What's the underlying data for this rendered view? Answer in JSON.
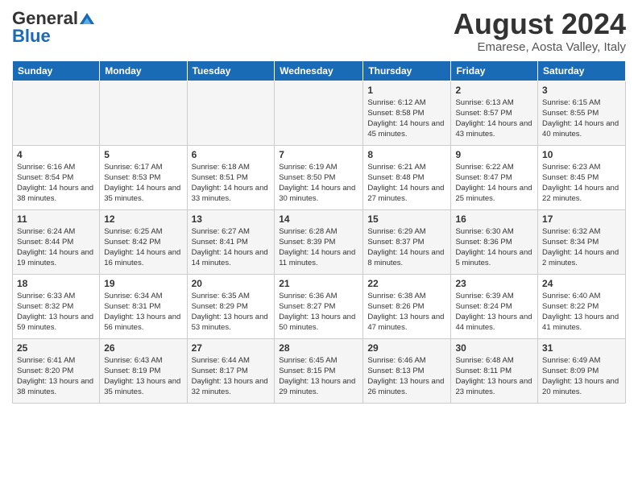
{
  "logo": {
    "general": "General",
    "blue": "Blue"
  },
  "title": "August 2024",
  "location": "Emarese, Aosta Valley, Italy",
  "days_of_week": [
    "Sunday",
    "Monday",
    "Tuesday",
    "Wednesday",
    "Thursday",
    "Friday",
    "Saturday"
  ],
  "weeks": [
    [
      {
        "day": "",
        "info": ""
      },
      {
        "day": "",
        "info": ""
      },
      {
        "day": "",
        "info": ""
      },
      {
        "day": "",
        "info": ""
      },
      {
        "day": "1",
        "info": "Sunrise: 6:12 AM\nSunset: 8:58 PM\nDaylight: 14 hours and 45 minutes."
      },
      {
        "day": "2",
        "info": "Sunrise: 6:13 AM\nSunset: 8:57 PM\nDaylight: 14 hours and 43 minutes."
      },
      {
        "day": "3",
        "info": "Sunrise: 6:15 AM\nSunset: 8:55 PM\nDaylight: 14 hours and 40 minutes."
      }
    ],
    [
      {
        "day": "4",
        "info": "Sunrise: 6:16 AM\nSunset: 8:54 PM\nDaylight: 14 hours and 38 minutes."
      },
      {
        "day": "5",
        "info": "Sunrise: 6:17 AM\nSunset: 8:53 PM\nDaylight: 14 hours and 35 minutes."
      },
      {
        "day": "6",
        "info": "Sunrise: 6:18 AM\nSunset: 8:51 PM\nDaylight: 14 hours and 33 minutes."
      },
      {
        "day": "7",
        "info": "Sunrise: 6:19 AM\nSunset: 8:50 PM\nDaylight: 14 hours and 30 minutes."
      },
      {
        "day": "8",
        "info": "Sunrise: 6:21 AM\nSunset: 8:48 PM\nDaylight: 14 hours and 27 minutes."
      },
      {
        "day": "9",
        "info": "Sunrise: 6:22 AM\nSunset: 8:47 PM\nDaylight: 14 hours and 25 minutes."
      },
      {
        "day": "10",
        "info": "Sunrise: 6:23 AM\nSunset: 8:45 PM\nDaylight: 14 hours and 22 minutes."
      }
    ],
    [
      {
        "day": "11",
        "info": "Sunrise: 6:24 AM\nSunset: 8:44 PM\nDaylight: 14 hours and 19 minutes."
      },
      {
        "day": "12",
        "info": "Sunrise: 6:25 AM\nSunset: 8:42 PM\nDaylight: 14 hours and 16 minutes."
      },
      {
        "day": "13",
        "info": "Sunrise: 6:27 AM\nSunset: 8:41 PM\nDaylight: 14 hours and 14 minutes."
      },
      {
        "day": "14",
        "info": "Sunrise: 6:28 AM\nSunset: 8:39 PM\nDaylight: 14 hours and 11 minutes."
      },
      {
        "day": "15",
        "info": "Sunrise: 6:29 AM\nSunset: 8:37 PM\nDaylight: 14 hours and 8 minutes."
      },
      {
        "day": "16",
        "info": "Sunrise: 6:30 AM\nSunset: 8:36 PM\nDaylight: 14 hours and 5 minutes."
      },
      {
        "day": "17",
        "info": "Sunrise: 6:32 AM\nSunset: 8:34 PM\nDaylight: 14 hours and 2 minutes."
      }
    ],
    [
      {
        "day": "18",
        "info": "Sunrise: 6:33 AM\nSunset: 8:32 PM\nDaylight: 13 hours and 59 minutes."
      },
      {
        "day": "19",
        "info": "Sunrise: 6:34 AM\nSunset: 8:31 PM\nDaylight: 13 hours and 56 minutes."
      },
      {
        "day": "20",
        "info": "Sunrise: 6:35 AM\nSunset: 8:29 PM\nDaylight: 13 hours and 53 minutes."
      },
      {
        "day": "21",
        "info": "Sunrise: 6:36 AM\nSunset: 8:27 PM\nDaylight: 13 hours and 50 minutes."
      },
      {
        "day": "22",
        "info": "Sunrise: 6:38 AM\nSunset: 8:26 PM\nDaylight: 13 hours and 47 minutes."
      },
      {
        "day": "23",
        "info": "Sunrise: 6:39 AM\nSunset: 8:24 PM\nDaylight: 13 hours and 44 minutes."
      },
      {
        "day": "24",
        "info": "Sunrise: 6:40 AM\nSunset: 8:22 PM\nDaylight: 13 hours and 41 minutes."
      }
    ],
    [
      {
        "day": "25",
        "info": "Sunrise: 6:41 AM\nSunset: 8:20 PM\nDaylight: 13 hours and 38 minutes."
      },
      {
        "day": "26",
        "info": "Sunrise: 6:43 AM\nSunset: 8:19 PM\nDaylight: 13 hours and 35 minutes."
      },
      {
        "day": "27",
        "info": "Sunrise: 6:44 AM\nSunset: 8:17 PM\nDaylight: 13 hours and 32 minutes."
      },
      {
        "day": "28",
        "info": "Sunrise: 6:45 AM\nSunset: 8:15 PM\nDaylight: 13 hours and 29 minutes."
      },
      {
        "day": "29",
        "info": "Sunrise: 6:46 AM\nSunset: 8:13 PM\nDaylight: 13 hours and 26 minutes."
      },
      {
        "day": "30",
        "info": "Sunrise: 6:48 AM\nSunset: 8:11 PM\nDaylight: 13 hours and 23 minutes."
      },
      {
        "day": "31",
        "info": "Sunrise: 6:49 AM\nSunset: 8:09 PM\nDaylight: 13 hours and 20 minutes."
      }
    ]
  ]
}
